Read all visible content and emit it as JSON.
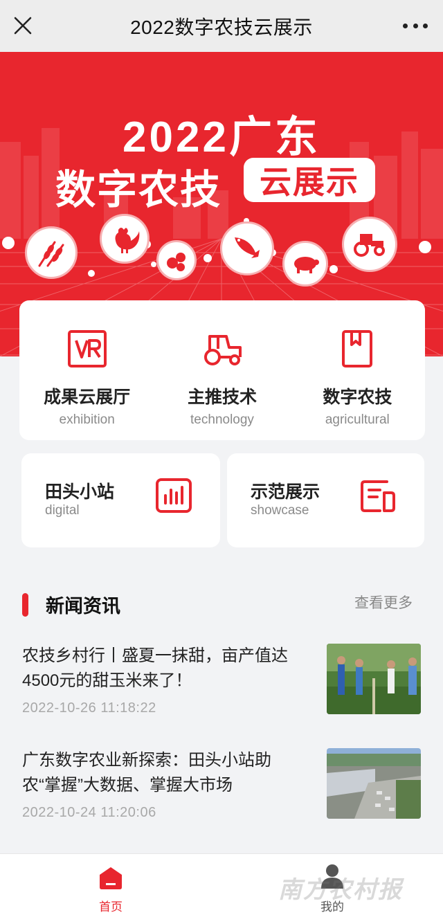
{
  "topbar": {
    "title": "2022数字农技云展示",
    "close_icon": "close-icon",
    "more_icon": "more-dots-icon"
  },
  "banner": {
    "line1": "2022广东",
    "line2": "数字农技",
    "pill": "云展示",
    "circle_icons": [
      "wheat-icon",
      "rooster-icon",
      "fruit-icon",
      "fish-icon",
      "pig-icon",
      "tractor-icon"
    ]
  },
  "features": [
    {
      "title": "成果云展厅",
      "subtitle": "exhibition",
      "icon": "vr-icon"
    },
    {
      "title": "主推技术",
      "subtitle": "technology",
      "icon": "tractor-icon"
    },
    {
      "title": "数字农技",
      "subtitle": "agricultural",
      "icon": "book-icon"
    }
  ],
  "tiles": [
    {
      "title": "田头小站",
      "subtitle": "digital",
      "icon": "bar-chart-icon"
    },
    {
      "title": "示范展示",
      "subtitle": "showcase",
      "icon": "document-icon"
    }
  ],
  "news": {
    "heading": "新闻资讯",
    "more": "查看更多",
    "items": [
      {
        "headline": "农技乡村行丨盛夏一抹甜，亩产值达4500元的甜玉米来了！",
        "date": "2022-10-26 11:18:22"
      },
      {
        "headline": "广东数字农业新探索：田头小站助农“掌握”大数据、掌握大市场",
        "date": "2022-10-24 11:20:06"
      }
    ]
  },
  "tabbar": {
    "home": "首页",
    "mine": "我的",
    "watermark": "南方农村报"
  },
  "colors": {
    "accent": "#e8262e",
    "background": "#f2f3f5"
  }
}
